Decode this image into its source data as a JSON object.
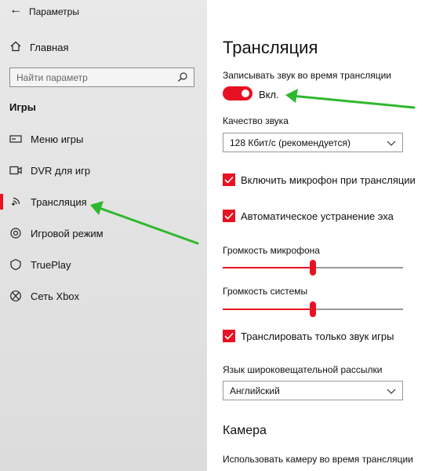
{
  "window": {
    "title": "Параметры"
  },
  "sidebar": {
    "home_label": "Главная",
    "search_placeholder": "Найти параметр",
    "section_title": "Игры",
    "items": [
      {
        "label": "Меню игры",
        "icon": "game-bar-icon",
        "active": false
      },
      {
        "label": "DVR для игр",
        "icon": "game-dvr-icon",
        "active": false
      },
      {
        "label": "Трансляция",
        "icon": "broadcast-icon",
        "active": true
      },
      {
        "label": "Игровой режим",
        "icon": "game-mode-icon",
        "active": false
      },
      {
        "label": "TruePlay",
        "icon": "trueplay-icon",
        "active": false
      },
      {
        "label": "Сеть Xbox",
        "icon": "xbox-icon",
        "active": false
      }
    ]
  },
  "main": {
    "title": "Трансляция",
    "record_audio": {
      "label": "Записывать звук во время трансляции",
      "state_label": "Вкл.",
      "on": true
    },
    "audio_quality": {
      "label": "Качество звука",
      "value": "128 Кбит/с (рекомендуется)"
    },
    "enable_mic": {
      "label": "Включить микрофон при трансляции",
      "checked": true
    },
    "echo_cancel": {
      "label": "Автоматическое устранение эха",
      "checked": true
    },
    "mic_volume": {
      "label": "Громкость микрофона",
      "value": 0.5
    },
    "system_volume": {
      "label": "Громкость системы",
      "value": 0.5
    },
    "game_audio_only": {
      "label": "Транслировать только звук игры",
      "checked": true
    },
    "language": {
      "label": "Язык широковещательной рассылки",
      "value": "Английский"
    },
    "camera_section": {
      "title": "Камера",
      "use_camera_label": "Использовать камеру во время трансляции"
    }
  },
  "colors": {
    "accent": "#e81123",
    "annotation_arrow": "#2eb82e"
  }
}
